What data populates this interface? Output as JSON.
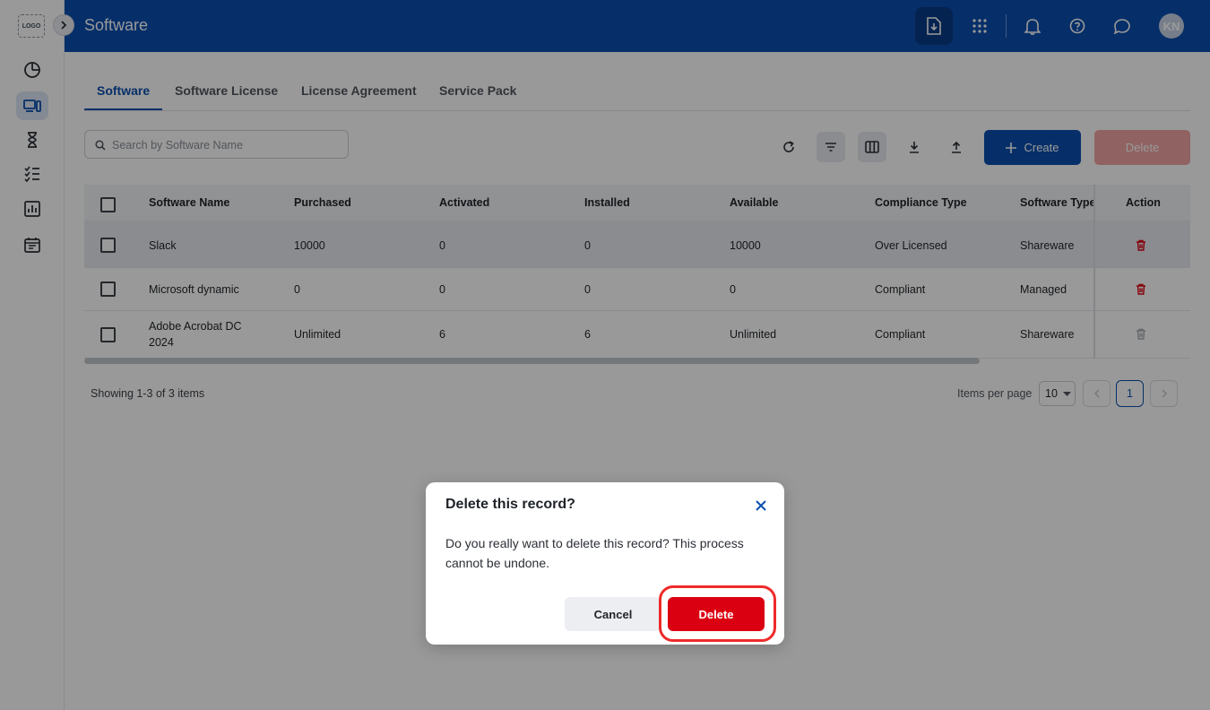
{
  "app": {
    "logo_text": "LOGO",
    "title": "Software",
    "user_initials": "KN"
  },
  "tabs": [
    {
      "label": "Software",
      "active": true
    },
    {
      "label": "Software License",
      "active": false
    },
    {
      "label": "License Agreement",
      "active": false
    },
    {
      "label": "Service Pack",
      "active": false
    }
  ],
  "search": {
    "placeholder": "Search by Software Name",
    "value": ""
  },
  "toolbar": {
    "create_label": "Create",
    "delete_label": "Delete"
  },
  "table": {
    "columns": [
      "Software Name",
      "Purchased",
      "Activated",
      "Installed",
      "Available",
      "Compliance Type",
      "Software Type",
      "Action"
    ],
    "rows": [
      {
        "name": "Slack",
        "purchased": "10000",
        "activated": "0",
        "installed": "0",
        "available": "10000",
        "compliance": "Over Licensed",
        "type": "Shareware"
      },
      {
        "name": "Microsoft dynamic",
        "purchased": "0",
        "activated": "0",
        "installed": "0",
        "available": "0",
        "compliance": "Compliant",
        "type": "Managed"
      },
      {
        "name": "Adobe Acrobat DC 2024",
        "purchased": "Unlimited",
        "activated": "6",
        "installed": "6",
        "available": "Unlimited",
        "compliance": "Compliant",
        "type": "Shareware"
      }
    ]
  },
  "pagination": {
    "showing": "Showing 1-3 of 3 items",
    "items_per_page_label": "Items per page",
    "items_per_page": "10",
    "current_page": "1"
  },
  "dialog": {
    "title": "Delete this record?",
    "message": "Do you really want to delete this record? This process cannot be undone.",
    "cancel_label": "Cancel",
    "confirm_label": "Delete"
  },
  "colors": {
    "brand": "#0b4fb0",
    "danger": "#db0011",
    "highlight": "#ee2a2a"
  }
}
